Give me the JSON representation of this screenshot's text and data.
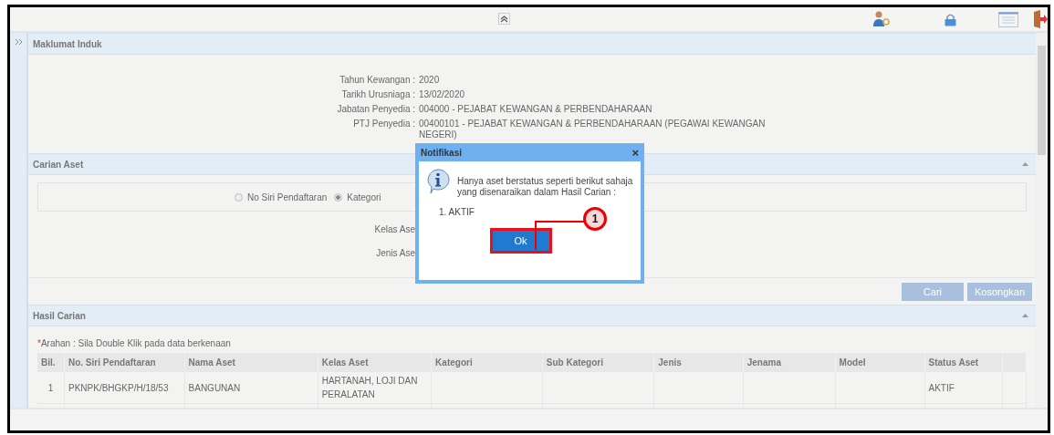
{
  "info_section": {
    "title": "Maklumat Induk",
    "fields": [
      {
        "label": "Tahun Kewangan :",
        "value": "2020"
      },
      {
        "label": "Tarikh Urusniaga :",
        "value": "13/02/2020"
      },
      {
        "label": "Jabatan Penyedia :",
        "value": "004000 - PEJABAT KEWANGAN & PERBENDAHARAAN"
      },
      {
        "label": "PTJ Penyedia :",
        "value": "00400101 - PEJABAT KEWANGAN & PERBENDAHARAAN (PEGAWAI KEWANGAN NEGERI)"
      }
    ]
  },
  "search_section": {
    "title": "Carian Aset",
    "search_by": [
      {
        "label": "No Siri Pendaftaran",
        "selected": false
      },
      {
        "label": "Kategori",
        "selected": true
      }
    ],
    "fields": [
      {
        "label": "Kelas Ase"
      },
      {
        "label": "Jenis Ase"
      }
    ],
    "buttons": [
      "Cari",
      "Kosongkan"
    ]
  },
  "results_section": {
    "title": "Hasil Carian",
    "note_mark": "*",
    "note": "Arahan : Sila Double Klik pada data berkenaan",
    "table": {
      "columns": [
        "Bil.",
        "No. Siri Pendaftaran",
        "Nama Aset",
        "Kelas Aset",
        "Kategori",
        "Sub Kategori",
        "Jenis",
        "Jenama",
        "Model",
        "Status Aset"
      ],
      "rows": [
        [
          "1",
          "PKNPK/BHGKP/H/18/53",
          "BANGUNAN",
          "HARTANAH, LOJI DAN PERALATAN",
          "",
          "",
          "",
          "",
          "",
          "AKTIF"
        ]
      ]
    }
  },
  "dialog": {
    "title": "Notifikasi",
    "close": "×",
    "message": "Hanya aset berstatus seperti berikut sahaja yang disenaraikan dalam Hasil Carian :",
    "items": [
      "1. AKTIF"
    ],
    "button": "Ok",
    "callout": "1"
  }
}
